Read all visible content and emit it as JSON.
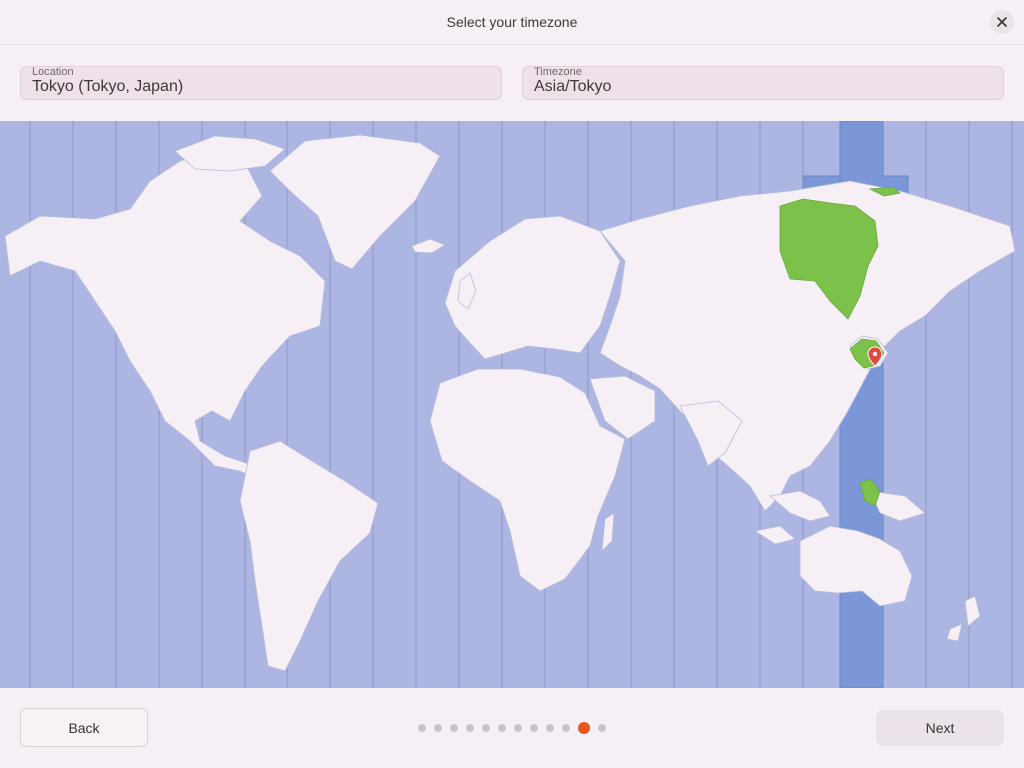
{
  "header": {
    "title": "Select your timezone"
  },
  "location": {
    "label": "Location",
    "value": "Tokyo (Tokyo, Japan)"
  },
  "timezone": {
    "label": "Timezone",
    "value": "Asia/Tokyo"
  },
  "footer": {
    "back_label": "Back",
    "next_label": "Next"
  },
  "progress": {
    "total_steps": 12,
    "current_step": 11
  },
  "colors": {
    "background": "#f6eff5",
    "ocean": "#adb5e3",
    "land": "#f6eff5",
    "selected_band": "#7b97d8",
    "selected_region": "#7cc24a",
    "accent": "#e95420",
    "pin": "#e8463a"
  },
  "icons": {
    "close": "close-icon",
    "pin": "location-pin-icon"
  }
}
